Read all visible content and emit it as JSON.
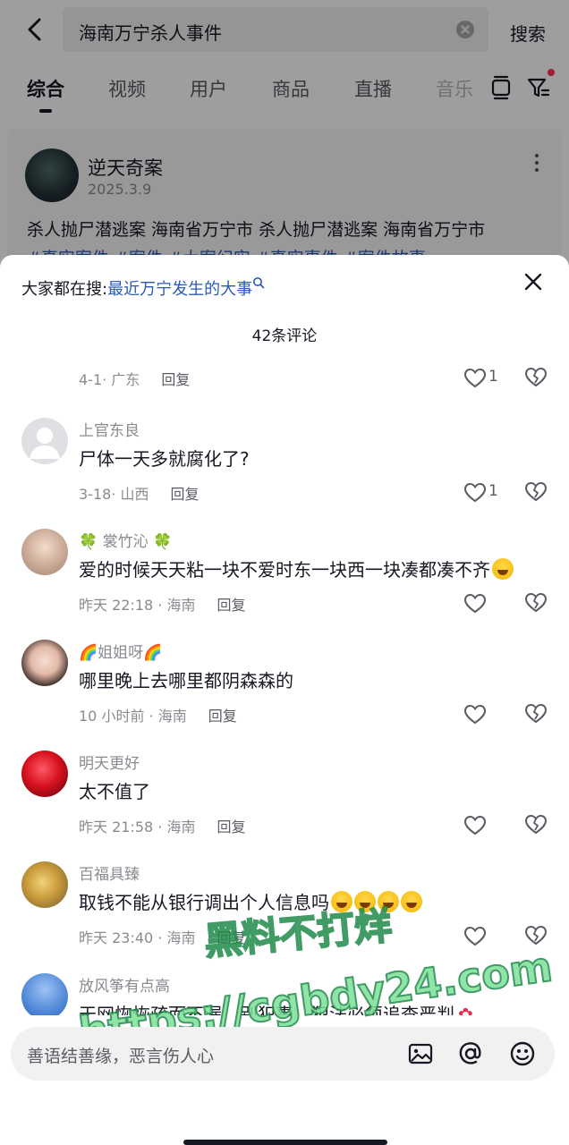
{
  "search": {
    "query": "海南万宁杀人事件",
    "button": "搜索"
  },
  "tabs": [
    "综合",
    "视频",
    "用户",
    "商品",
    "直播",
    "音乐"
  ],
  "active_tab": "综合",
  "post": {
    "author": "逆天奇案",
    "date": "2025.3.9",
    "text": "杀人抛尸潜逃案 海南省万宁市 杀人抛尸潜逃案 海南省万宁市",
    "tags": "#真实案件 #案件 #大案纪实 #真实事件 #案件故事"
  },
  "sheet": {
    "hot_prefix": "大家都在搜:",
    "hot_link": "最近万宁发生的大事",
    "count": "42条评论",
    "comments": [
      {
        "name": "",
        "text": "",
        "time": "4-1· 广东",
        "reply": "回复",
        "likes": "1"
      },
      {
        "name": "上官东良",
        "text": "尸体一天多就腐化了?",
        "time": "3-18· 山西",
        "reply": "回复",
        "likes": "1"
      },
      {
        "name": "🍀 裳竹沁 🍀",
        "text": "爱的时候天天粘一块不爱时东一块西一块凑都凑不齐",
        "time": "昨天 22:18 · 海南",
        "reply": "回复",
        "likes": ""
      },
      {
        "name": "🌈姐姐呀🌈",
        "text": "哪里晚上去哪里都阴森森的",
        "time": "10 小时前 · 海南",
        "reply": "回复",
        "likes": ""
      },
      {
        "name": "明天更好",
        "text": "太不值了",
        "time": "昨天 21:58 · 海南",
        "reply": "回复",
        "likes": ""
      },
      {
        "name": "百福具臻",
        "text": "取钱不能从银行调出个人信息吗",
        "time": "昨天 23:40 · 海南",
        "reply": "回复",
        "likes": ""
      },
      {
        "name": "放风筝有点高",
        "text": "天网恢恢疏而不漏，别犯事，犯法必须追查严判",
        "time": "",
        "reply": "",
        "likes": ""
      }
    ],
    "input_placeholder": "善语结善缘，恶言伤人心"
  },
  "watermark": {
    "line1": "黑料不打烊",
    "line2": "https://cgbdy24.com"
  },
  "colors": {
    "accent_red": "#fe2c55",
    "link_blue": "#2b5bb5",
    "text_main": "#161823",
    "text_muted": "#8a8b91"
  }
}
